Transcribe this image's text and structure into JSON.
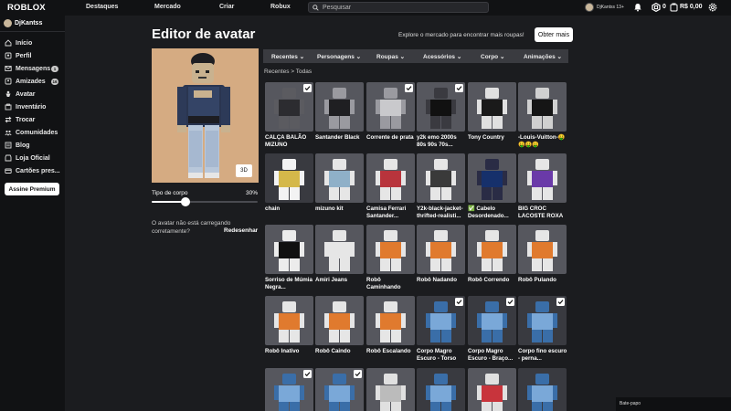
{
  "header": {
    "logo": "ROBLOX",
    "nav": [
      "Destaques",
      "Mercado",
      "Criar",
      "Robux"
    ],
    "search_placeholder": "Pesquisar",
    "username": "DjKantss",
    "age_tag": "13+",
    "robux": "0",
    "money": "R$ 0,00"
  },
  "sidebar": {
    "username": "DjKantss",
    "items": [
      {
        "label": "Início",
        "icon": "home-icon"
      },
      {
        "label": "Perfil",
        "icon": "profile-icon"
      },
      {
        "label": "Mensagens",
        "icon": "messages-icon",
        "badge": "1"
      },
      {
        "label": "Amizades",
        "icon": "friends-icon",
        "badge": "16"
      },
      {
        "label": "Avatar",
        "icon": "avatar-icon"
      },
      {
        "label": "Inventário",
        "icon": "inventory-icon"
      },
      {
        "label": "Trocar",
        "icon": "trade-icon"
      },
      {
        "label": "Comunidades",
        "icon": "communities-icon"
      },
      {
        "label": "Blog",
        "icon": "blog-icon"
      },
      {
        "label": "Loja Oficial",
        "icon": "store-icon"
      },
      {
        "label": "Cartões pres...",
        "icon": "giftcard-icon"
      }
    ],
    "premium_button": "Assine Premium"
  },
  "main": {
    "title": "Editor de avatar",
    "promo_text": "Explore o mercado para encontrar mais roupas!",
    "get_more_button": "Obter mais",
    "view_toggle": "3D",
    "body_type_label": "Tipo de corpo",
    "body_type_value": "30%",
    "body_type_fraction": 0.3,
    "not_loading_text": "O avatar não está carregando corretamente?",
    "redraw_button": "Redesenhar",
    "categories": [
      "Recentes",
      "Personagens",
      "Roupas",
      "Acessórios",
      "Corpo",
      "Animações"
    ],
    "breadcrumb": "Recentes > Todas",
    "items": [
      {
        "name": "CALÇA BALÃO MIZUNO",
        "checked": true
      },
      {
        "name": "Santander Black",
        "checked": false
      },
      {
        "name": "Corrente de prata",
        "checked": true
      },
      {
        "name": "y2k emo 2000s 80s 90s 70s...",
        "checked": true
      },
      {
        "name": "Tony Country",
        "checked": false
      },
      {
        "name": "-Louis-Vuitton-🤑🤑🤑🤑",
        "checked": false
      },
      {
        "name": "chain",
        "checked": false
      },
      {
        "name": "mizuno kit",
        "checked": false
      },
      {
        "name": "Camisa Ferrari Santander...",
        "checked": false
      },
      {
        "name": "Y2k-black-jacket-thrifted-realisti...",
        "checked": false
      },
      {
        "name": "✅ Cabelo Desordenado...",
        "checked": false
      },
      {
        "name": "BIG CROC LACOSTE ROXA",
        "checked": false
      },
      {
        "name": "Sorriso de Múmia Negra...",
        "checked": false
      },
      {
        "name": "Amiri Jeans",
        "checked": false
      },
      {
        "name": "Robô Caminhando",
        "checked": false
      },
      {
        "name": "Robô Nadando",
        "checked": false
      },
      {
        "name": "Robô Correndo",
        "checked": false
      },
      {
        "name": "Robô Pulando",
        "checked": false
      },
      {
        "name": "Robô Inativo",
        "checked": false
      },
      {
        "name": "Robô Caindo",
        "checked": false
      },
      {
        "name": "Robô Escalando",
        "checked": false
      },
      {
        "name": "Corpo Magro Escuro - Torso",
        "checked": true
      },
      {
        "name": "Corpo Magro Escuro - Braço...",
        "checked": true
      },
      {
        "name": "Corpo fino escuro - perna...",
        "checked": true
      },
      {
        "name": "",
        "checked": true
      },
      {
        "name": "",
        "checked": true
      },
      {
        "name": "",
        "checked": false
      },
      {
        "name": "",
        "checked": false
      },
      {
        "name": "",
        "checked": false
      },
      {
        "name": "",
        "checked": false
      }
    ]
  },
  "footer": {
    "chat_label": "Bate-papo"
  }
}
